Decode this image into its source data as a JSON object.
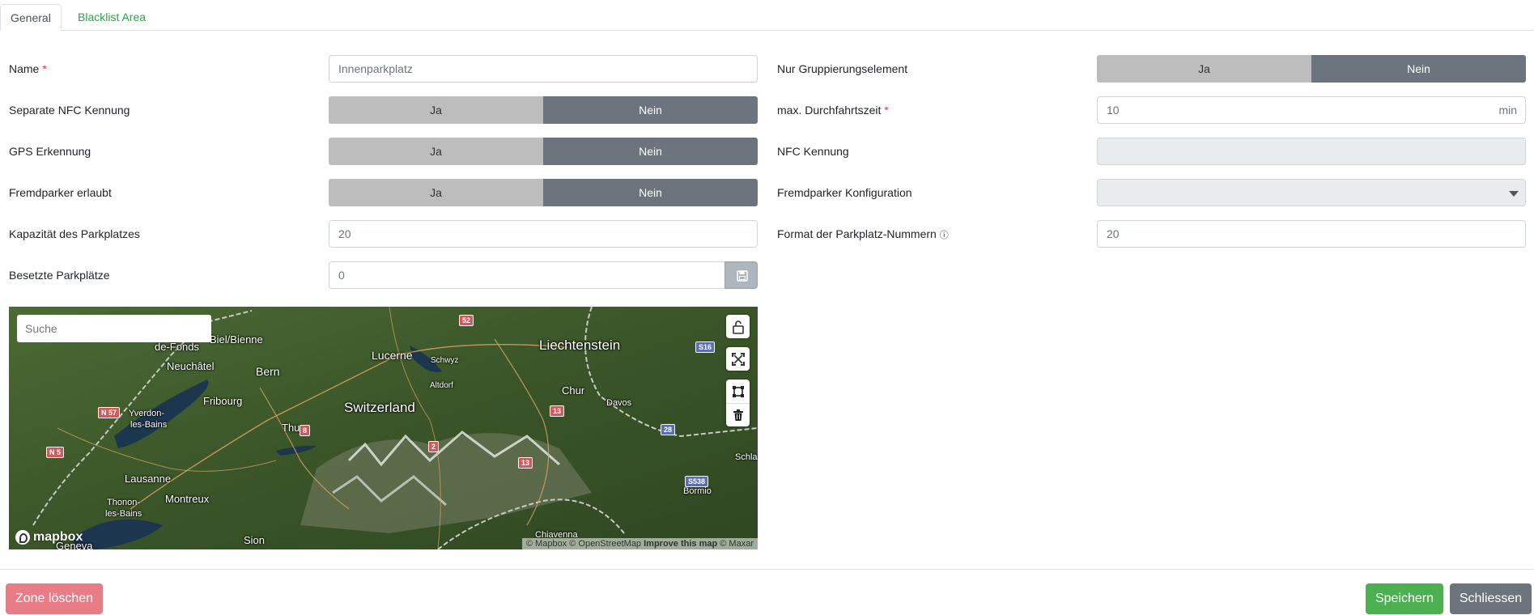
{
  "tabs": [
    {
      "label": "General"
    },
    {
      "label": "Blacklist Area"
    }
  ],
  "form": {
    "name": {
      "label": "Name",
      "required": "*",
      "value": "Innenparkplatz"
    },
    "separate_nfc": {
      "label": "Separate NFC Kennung",
      "yes": "Ja",
      "no": "Nein",
      "selected": "Nein"
    },
    "gps": {
      "label": "GPS Erkennung",
      "yes": "Ja",
      "no": "Nein",
      "selected": "Nein"
    },
    "fremdparker": {
      "label": "Fremdparker erlaubt",
      "yes": "Ja",
      "no": "Nein",
      "selected": "Nein"
    },
    "kapazitaet": {
      "label": "Kapazität des Parkplatzes",
      "value": "20"
    },
    "besetzt": {
      "label": "Besetzte Parkplätze",
      "value": "0"
    },
    "gruppierung": {
      "label": "Nur Gruppierungselement",
      "yes": "Ja",
      "no": "Nein",
      "selected": "Nein"
    },
    "durchfahrtszeit": {
      "label": "max. Durchfahrtszeit",
      "required": "*",
      "value": "10",
      "unit": "min"
    },
    "nfc_kennung": {
      "label": "NFC Kennung",
      "value": ""
    },
    "fremdparker_konfig": {
      "label": "Fremdparker Konfiguration",
      "value": ""
    },
    "format_nummern": {
      "label": "Format der Parkplatz-Nummern",
      "info_icon": "ⓘ",
      "value": "20"
    }
  },
  "map": {
    "search_placeholder": "Suche",
    "logo": "mapbox",
    "attribution": {
      "mapbox": "© Mapbox",
      "osm": "© OpenStreetMap",
      "improve": "Improve this map",
      "maxar": "© Maxar"
    },
    "places": {
      "liechtenstein": "Liechtenstein",
      "switzerland": "Switzerland",
      "lucerne": "Lucerne",
      "bern": "Bern",
      "biel": "Biel/Bienne",
      "neuchatel": "Neuchâtel",
      "fonds": "de-Fonds",
      "schwyz": "Schwyz",
      "altdorf": "Altdorf",
      "chur": "Chur",
      "davos": "Davos",
      "fribourg": "Fribourg",
      "thun": "Thun",
      "yverdon": "Yverdon-",
      "les_bains": "les-Bains",
      "lausanne": "Lausanne",
      "montreux": "Montreux",
      "thonon": "Thonon-",
      "thonon2": "les-Bains",
      "sion": "Sion",
      "geneva": "Geneva",
      "bormio": "Bormio",
      "chiavenna": "Chiavenna",
      "schla": "Schla"
    },
    "shields": {
      "n57": "N 57",
      "n5": "N 5",
      "s2": "52",
      "s16": "S16",
      "s13a": "13",
      "s8": "8",
      "s2b": "2",
      "s13b": "13",
      "s28": "28",
      "s538": "S538"
    },
    "controls": [
      "unlock-icon",
      "fullscreen-icon",
      "polygon-icon",
      "trash-icon"
    ]
  },
  "buttons": {
    "delete": "Zone löschen",
    "save": "Speichern",
    "close": "Schliessen"
  },
  "colors": {
    "primary_green": "#28a745",
    "toggle_active": "#6c757d",
    "toggle_inactive": "#bdbdbd",
    "danger": "#e87d86",
    "required": "#dc3545"
  }
}
